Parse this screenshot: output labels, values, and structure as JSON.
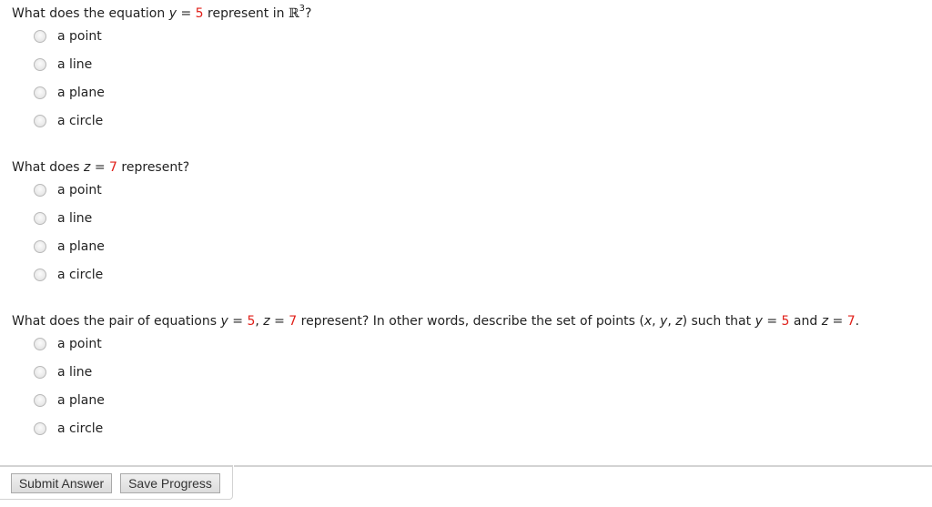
{
  "questions": [
    {
      "parts": {
        "before": "What does the equation ",
        "var1": "y",
        "eq1": " = ",
        "num1": "5",
        "mid": " represent in ",
        "space_symbol": "ℝ",
        "space_exp": "3",
        "end": "?"
      },
      "options": [
        "a point",
        "a line",
        "a plane",
        "a circle"
      ]
    },
    {
      "parts": {
        "before": "What does ",
        "var1": "z",
        "eq1": " = ",
        "num1": "7",
        "end": " represent?"
      },
      "options": [
        "a point",
        "a line",
        "a plane",
        "a circle"
      ]
    },
    {
      "parts": {
        "before": "What does the pair of equations ",
        "var1": "y",
        "eq1": " = ",
        "num1": "5",
        "sep": ", ",
        "var2": "z",
        "eq2": " = ",
        "num2": "7",
        "mid": " represent? In other words, describe the set of points (",
        "px": "x",
        "c1": ", ",
        "py": "y",
        "c2": ", ",
        "pz": "z",
        "mid2": ") such that ",
        "var3": "y",
        "eq3": " = ",
        "num3": "5",
        "and": " and ",
        "var4": "z",
        "eq4": " = ",
        "num4": "7",
        "end": "."
      },
      "options": [
        "a point",
        "a line",
        "a plane",
        "a circle"
      ]
    }
  ],
  "buttons": {
    "submit": "Submit Answer",
    "save": "Save Progress"
  },
  "colors": {
    "highlight_number": "#e0201a"
  }
}
